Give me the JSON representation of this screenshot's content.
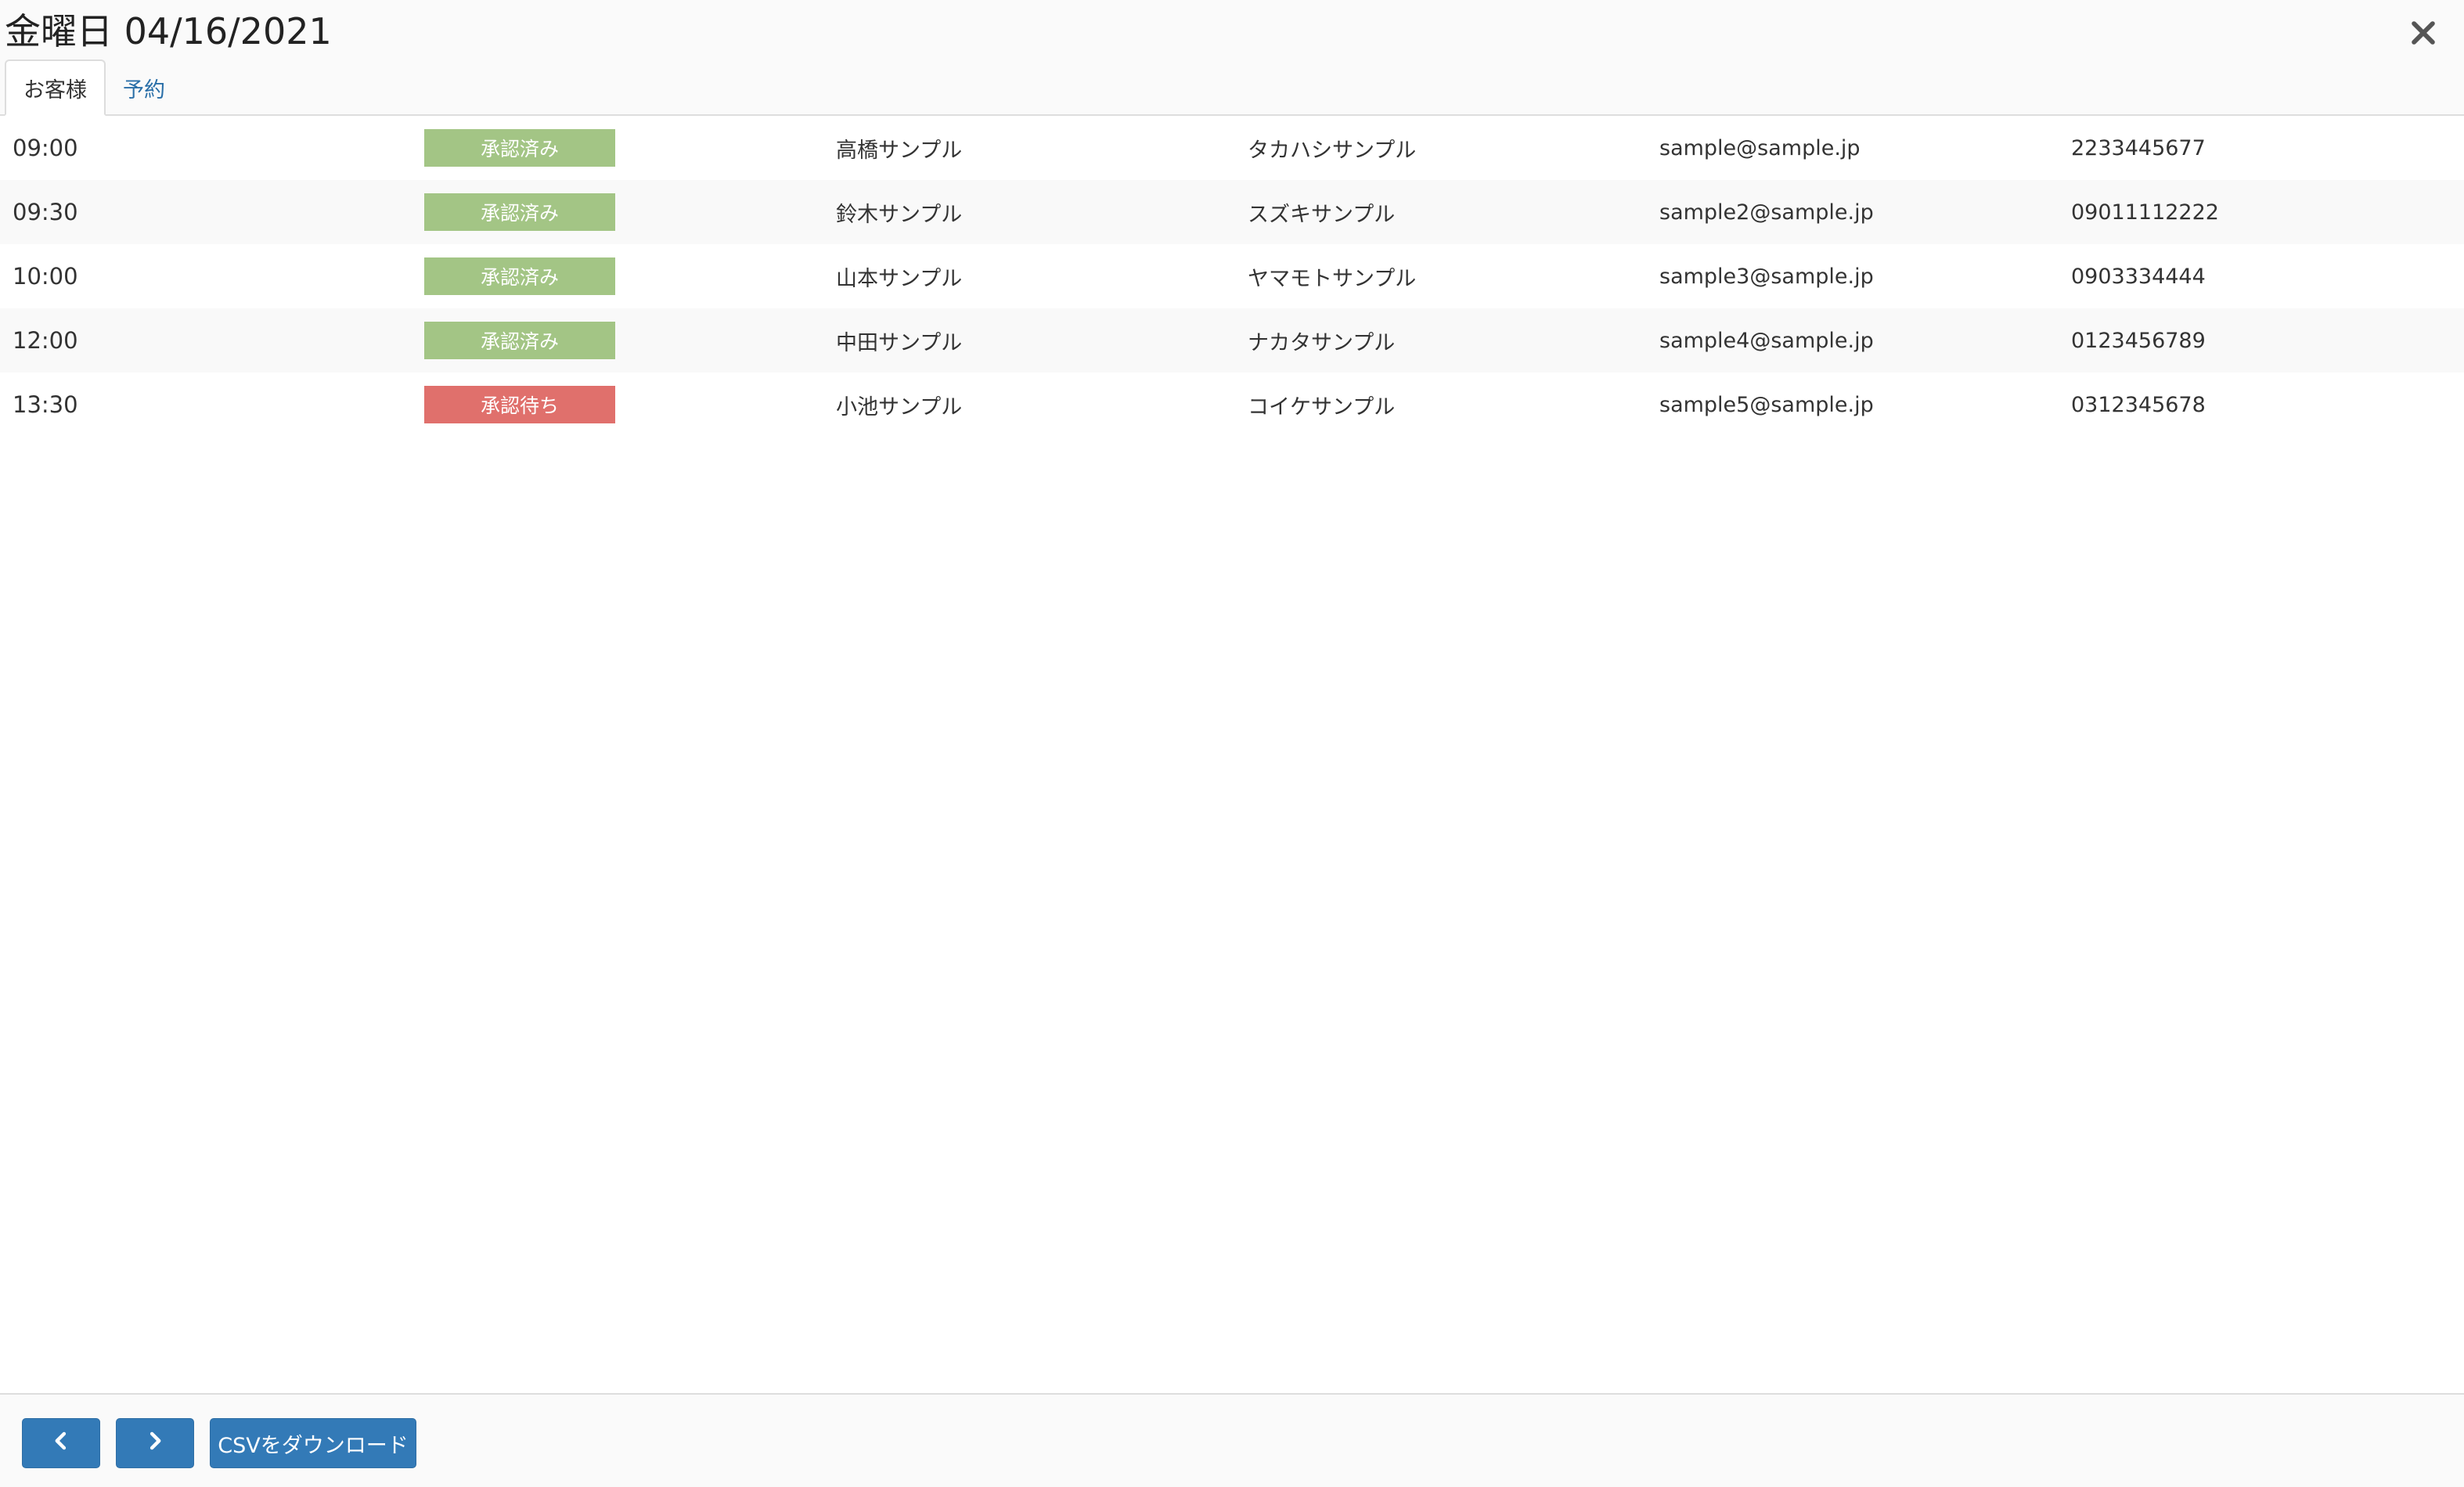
{
  "header": {
    "title": "金曜日 04/16/2021",
    "close_icon": "close-icon"
  },
  "tabs": [
    {
      "label": "お客様",
      "active": true
    },
    {
      "label": "予約",
      "active": false
    }
  ],
  "rows": [
    {
      "time": "09:00",
      "status": "承認済み",
      "name": "高橋サンプル",
      "kana": "タカハシサンプル",
      "email": "sample@sample.jp",
      "phone": "2233445677"
    },
    {
      "time": "09:30",
      "status": "承認済み",
      "name": "鈴木サンプル",
      "kana": "スズキサンプル",
      "email": "sample2@sample.jp",
      "phone": "09011112222"
    },
    {
      "time": "10:00",
      "status": "承認済み",
      "name": "山本サンプル",
      "kana": "ヤマモトサンプル",
      "email": "sample3@sample.jp",
      "phone": "0903334444"
    },
    {
      "time": "12:00",
      "status": "承認済み",
      "name": "中田サンプル",
      "kana": "ナカタサンプル",
      "email": "sample4@sample.jp",
      "phone": "0123456789"
    },
    {
      "time": "13:30",
      "status": "承認待ち",
      "name": "小池サンプル",
      "kana": "コイケサンプル",
      "email": "sample5@sample.jp",
      "phone": "0312345678"
    }
  ],
  "colors": {
    "approved": "#a3c585",
    "pending": "#e0706c",
    "primary": "#337ab7",
    "link": "#2a6fa8"
  },
  "footer": {
    "prev_icon": "chevron-left-icon",
    "next_icon": "chevron-right-icon",
    "csv_label": "CSVをダウンロード"
  }
}
